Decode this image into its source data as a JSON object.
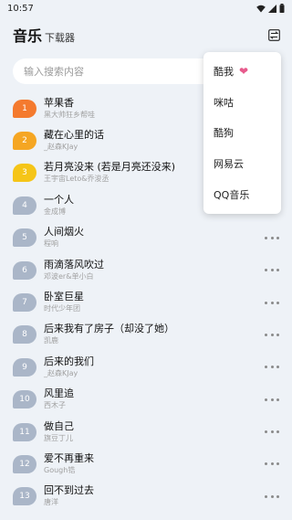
{
  "status": {
    "time": "10:57"
  },
  "header": {
    "title": "音乐",
    "subtitle": "下载器"
  },
  "search": {
    "placeholder": "输入搜索内容",
    "value": ""
  },
  "colors": {
    "rank1": "#f47a2e",
    "rank2": "#f5a623",
    "rank3": "#f5c518",
    "rank_default": "#aab6c8",
    "heart": "#e75a8c"
  },
  "songs": [
    {
      "rank": "1",
      "title": "苹果香",
      "artist": "黑大帅狂乡帮哇"
    },
    {
      "rank": "2",
      "title": "藏在心里的话",
      "artist": "_赵森KJay"
    },
    {
      "rank": "3",
      "title": "若月亮没来 (若是月亮还没来)",
      "artist": "王宇宙Leto&乔浚丞"
    },
    {
      "rank": "4",
      "title": "一个人",
      "artist": "金成博"
    },
    {
      "rank": "5",
      "title": "人间烟火",
      "artist": "程响"
    },
    {
      "rank": "6",
      "title": "雨滴落风吹过",
      "artist": "邓波er&单小白"
    },
    {
      "rank": "7",
      "title": "卧室巨星",
      "artist": "时代少年团"
    },
    {
      "rank": "8",
      "title": "后来我有了房子（却没了她）",
      "artist": "凯鹿"
    },
    {
      "rank": "9",
      "title": "后来的我们",
      "artist": "_赵森KJay"
    },
    {
      "rank": "10",
      "title": "风里追",
      "artist": "西木子"
    },
    {
      "rank": "11",
      "title": "做自己",
      "artist": "旗豆丁儿"
    },
    {
      "rank": "12",
      "title": "爱不再重来",
      "artist": "Gough锆"
    },
    {
      "rank": "13",
      "title": "回不到过去",
      "artist": "唐洋"
    }
  ],
  "menu": {
    "items": [
      {
        "label": "酷我",
        "icon": "heart-icon"
      },
      {
        "label": "咪咕"
      },
      {
        "label": "酷狗"
      },
      {
        "label": "网易云"
      },
      {
        "label": "QQ音乐"
      }
    ]
  }
}
